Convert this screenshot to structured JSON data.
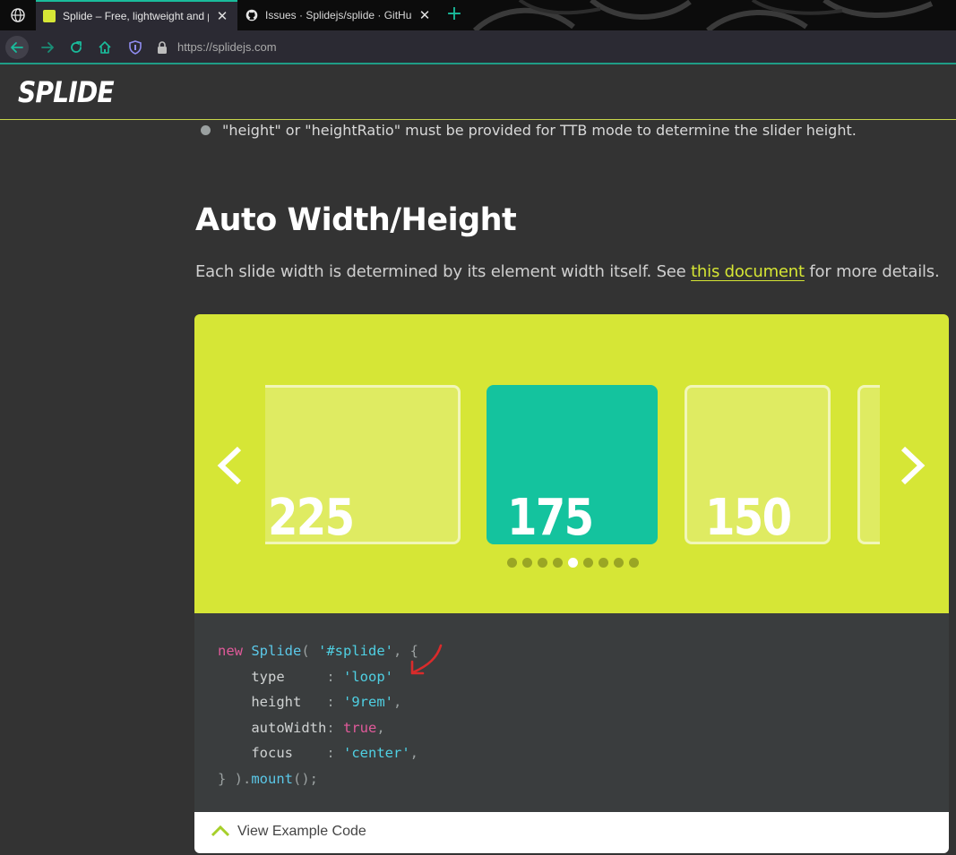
{
  "browser": {
    "tabs": [
      {
        "title": "Splide – Free, lightweight and p",
        "active": true
      },
      {
        "title": "Issues · Splidejs/splide · GitHub",
        "active": false
      }
    ],
    "close_glyph": "✕",
    "new_tab_glyph": "+",
    "url": "https://splidejs.com",
    "accent_color": "#1abc9c"
  },
  "site": {
    "logo": "SPLIDE",
    "bullet_text": "\"height\" or \"heightRatio\" must be provided for TTB mode to determine the slider height.",
    "section_title": "Auto Width/Height",
    "paragraph": {
      "before": "Each slide width is determined by its element width itself. See ",
      "link": "this document",
      "after": " for more details."
    }
  },
  "slider": {
    "bg_color": "#d6e636",
    "active_color": "#14c39e",
    "slides": [
      {
        "label": "225",
        "active": false
      },
      {
        "label": "175",
        "active": true
      },
      {
        "label": "150",
        "active": false
      },
      {
        "label": "",
        "active": false
      }
    ],
    "pagination": {
      "count": 9,
      "current": 5
    }
  },
  "code": {
    "lines": [
      "new Splide( '#splide', {",
      "    type     : 'loop'",
      "    height   : '9rem',",
      "    autoWidth: true,",
      "    focus    : 'center',",
      "} ).mount();"
    ]
  },
  "view_code": {
    "label": "View Example Code"
  }
}
